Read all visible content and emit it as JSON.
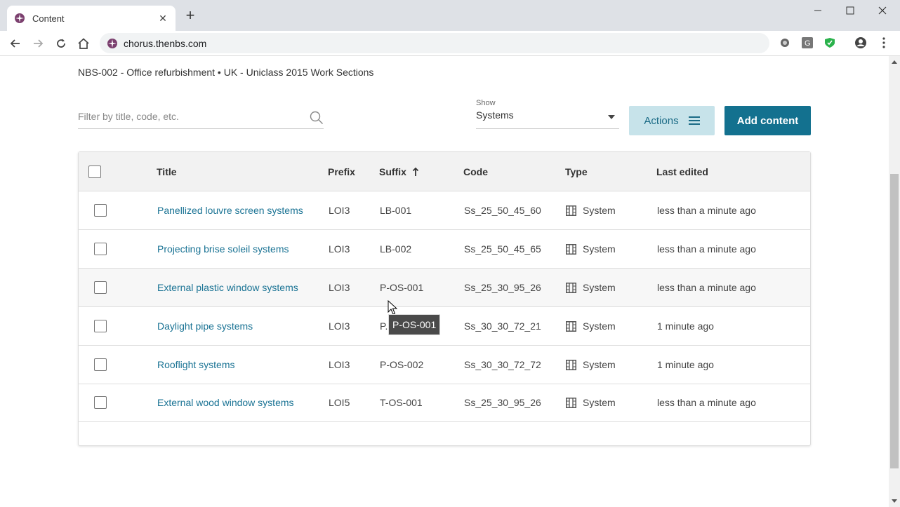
{
  "browser": {
    "tab_title": "Content",
    "tab_close": "✕",
    "new_tab": "+",
    "url": "chorus.thenbs.com",
    "brand_color": "#7b3f6e"
  },
  "page": {
    "breadcrumb": "NBS-002 - Office refurbishment • UK - Uniclass 2015 Work Sections",
    "filter_placeholder": "Filter by title, code, etc.",
    "show_label": "Show",
    "show_value": "Systems",
    "actions_label": "Actions",
    "add_content_label": "Add content",
    "accent_color": "#13718f"
  },
  "table": {
    "headers": {
      "title": "Title",
      "prefix": "Prefix",
      "suffix": "Suffix",
      "code": "Code",
      "type": "Type",
      "last_edited": "Last edited"
    },
    "sort_column": "Suffix",
    "sort_direction": "ascending",
    "rows": [
      {
        "title": "Panellized louvre screen systems",
        "prefix": "LOI3",
        "suffix": "LB-001",
        "code": "Ss_25_50_45_60",
        "type": "System",
        "last_edited": "less than a minute ago"
      },
      {
        "title": "Projecting brise soleil systems",
        "prefix": "LOI3",
        "suffix": "LB-002",
        "code": "Ss_25_50_45_65",
        "type": "System",
        "last_edited": "less than a minute ago"
      },
      {
        "title": "External plastic window systems",
        "prefix": "LOI3",
        "suffix": "P-OS-001",
        "code": "Ss_25_30_95_26",
        "type": "System",
        "last_edited": "less than a minute ago"
      },
      {
        "title": "Daylight pipe systems",
        "prefix": "LOI3",
        "suffix": "P.",
        "code": "Ss_30_30_72_21",
        "type": "System",
        "last_edited": "1 minute ago"
      },
      {
        "title": "Rooflight systems",
        "prefix": "LOI3",
        "suffix": "P-OS-002",
        "code": "Ss_30_30_72_72",
        "type": "System",
        "last_edited": "1 minute ago"
      },
      {
        "title": "External wood window systems",
        "prefix": "LOI5",
        "suffix": "T-OS-001",
        "code": "Ss_25_30_95_26",
        "type": "System",
        "last_edited": "less than a minute ago"
      }
    ]
  },
  "tooltip": "P-OS-001"
}
